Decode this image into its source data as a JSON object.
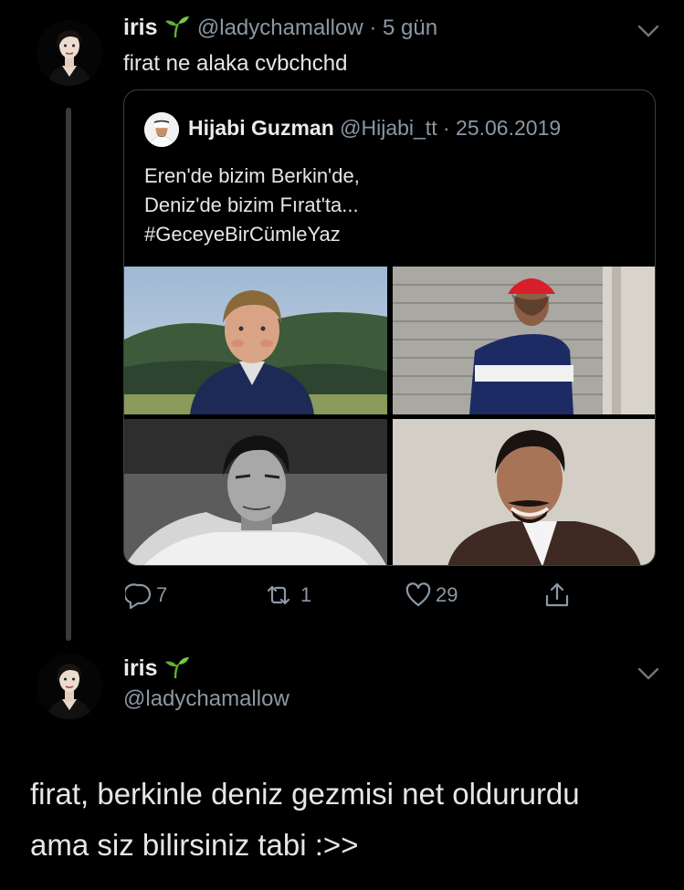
{
  "tweet1": {
    "name": "iris",
    "handle": "@ladychamallow",
    "separator": "·",
    "time": "5 gün",
    "text": "firat ne alaka cvbchchd"
  },
  "quoted_tweet": {
    "name": "Hijabi Guzman",
    "handle": "@Hijabi_tt",
    "separator": "·",
    "date": "25.06.2019",
    "lines": [
      "Eren'de bizim Berkin'de,",
      "Deniz'de bizim Fırat'ta...",
      "#GeceyeBirCümleYaz"
    ],
    "photos": [
      "boy-in-blue-jacket-mountains",
      "teen-red-cap-tracksuit",
      "bw-man-fur-collar",
      "smiling-man-mustache"
    ]
  },
  "actions": {
    "reply_count": "7",
    "retweet_count": "1",
    "like_count": "29"
  },
  "tweet2": {
    "name": "iris",
    "handle": "@ladychamallow",
    "lines": [
      "firat, berkinle deniz gezmisi net oldururdu",
      "ama siz bilirsiniz tabi :>>"
    ]
  },
  "colors": {
    "background": "#000000",
    "muted": "#8b98a5",
    "sprout": "#5fb236",
    "border": "#3a3f45"
  },
  "icons": [
    "sprout-emoji",
    "chevron-down-icon",
    "reply-icon",
    "retweet-icon",
    "like-icon",
    "share-icon"
  ]
}
